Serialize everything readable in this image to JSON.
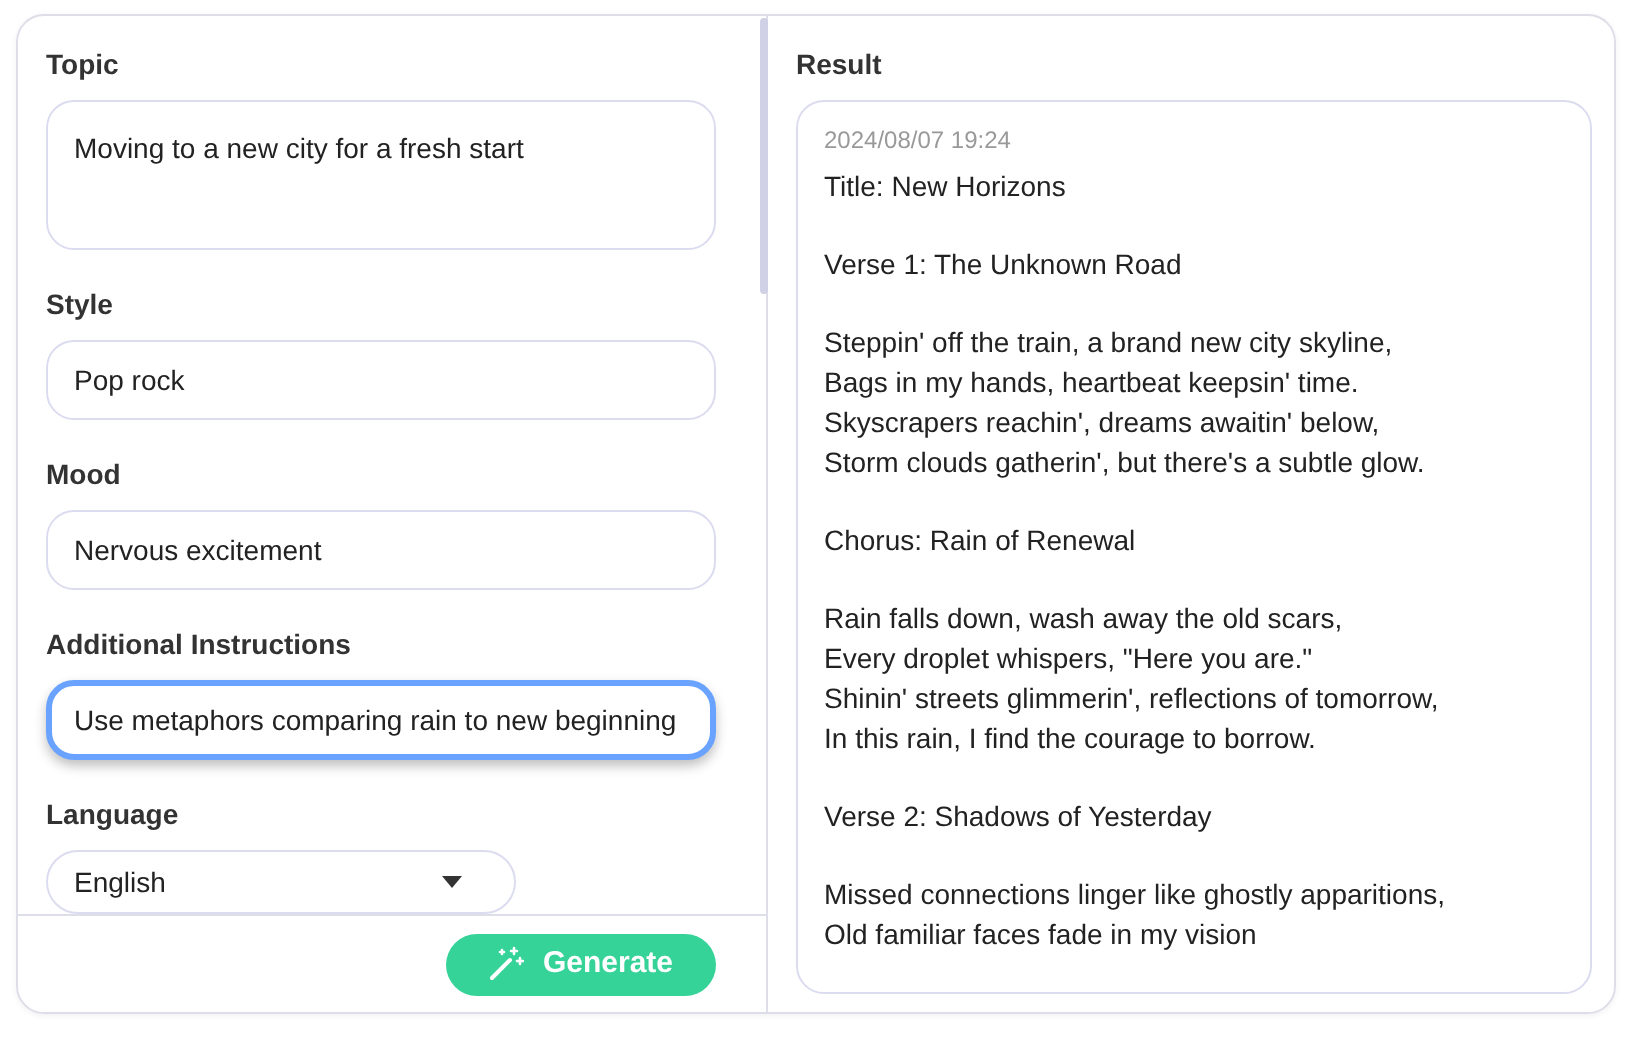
{
  "form": {
    "fields": [
      {
        "label": "Topic",
        "kind": "textarea",
        "value": "Moving to a new city for a fresh start",
        "focused": false
      },
      {
        "label": "Style",
        "kind": "text",
        "value": "Pop rock",
        "focused": false
      },
      {
        "label": "Mood",
        "kind": "text",
        "value": "Nervous excitement",
        "focused": false
      },
      {
        "label": "Additional Instructions",
        "kind": "text",
        "value": "Use metaphors comparing rain to new beginning",
        "focused": true
      },
      {
        "label": "Language",
        "kind": "select",
        "value": "English",
        "focused": false
      }
    ],
    "generate_button": "Generate"
  },
  "result": {
    "label": "Result",
    "timestamp": "2024/08/07 19:24",
    "stanzas": [
      [
        "Title: New Horizons"
      ],
      [
        "Verse 1: The Unknown Road"
      ],
      [
        "Steppin' off the train, a brand new city skyline,",
        "Bags in my hands, heartbeat keepsin' time.",
        "Skyscrapers reachin', dreams awaitin' below,",
        "Storm clouds gatherin', but there's a subtle glow."
      ],
      [
        "Chorus: Rain of Renewal"
      ],
      [
        "Rain falls down, wash away the old scars,",
        "Every droplet whispers, \"Here you are.\"",
        "Shinin' streets glimmerin', reflections of tomorrow,",
        "In this rain, I find the courage to borrow."
      ],
      [
        "Verse 2: Shadows of Yesterday"
      ],
      [
        "Missed connections linger like ghostly apparitions,",
        "Old familiar faces fade in my vision"
      ]
    ]
  }
}
